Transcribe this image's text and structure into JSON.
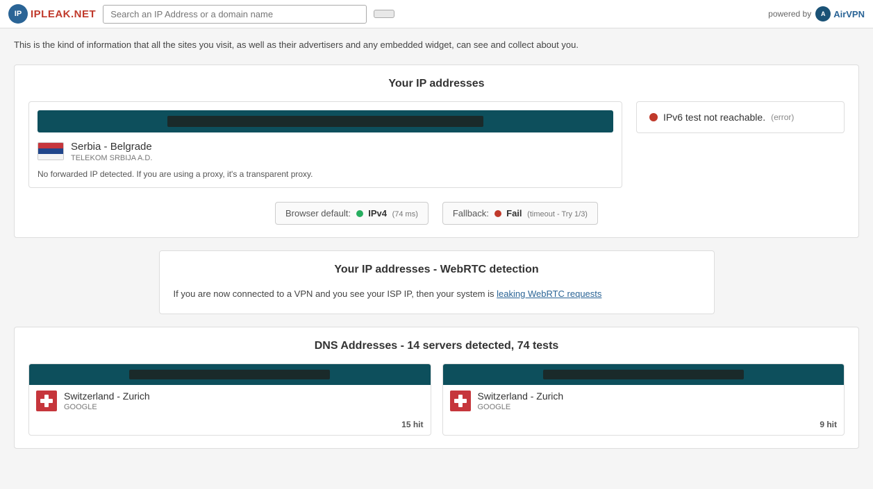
{
  "header": {
    "logo_text_part1": "IPLEAK",
    "logo_text_part2": ".NET",
    "search_placeholder": "Search an IP Address or a domain name",
    "search_button_label": "",
    "powered_by_text": "powered by",
    "airvpn_label": "AirVPN"
  },
  "intro": {
    "text": "This is the kind of information that all the sites you visit, as well as their advertisers and any embedded widget, can see and collect about you."
  },
  "ip_section": {
    "title": "Your IP addresses",
    "location": "Serbia - Belgrade",
    "isp": "TELEKOM SRBIJA a.d.",
    "no_forward_text": "No forwarded IP detected. If you are using a proxy, it's a transparent proxy.",
    "ipv6_label": "IPv6 test not reachable.",
    "ipv6_error": "(error)",
    "browser_default_label": "Browser default:",
    "browser_default_protocol": "IPv4",
    "browser_default_ms": "(74 ms)",
    "fallback_label": "Fallback:",
    "fallback_status": "Fail",
    "fallback_meta": "(timeout - Try 1/3)"
  },
  "webrtc_section": {
    "title": "Your IP addresses - WebRTC detection",
    "text": "If you are now connected to a VPN and you see your ISP IP, then your system is",
    "link_text": "leaking WebRTC requests"
  },
  "dns_section": {
    "title": "DNS Addresses - 14 servers detected, 74 tests",
    "cards": [
      {
        "country": "Switzerland - Zurich",
        "isp": "GOOGLE",
        "hits": "15 hit"
      },
      {
        "country": "Switzerland - Zurich",
        "isp": "GOOGLE",
        "hits": "9 hit"
      }
    ]
  }
}
